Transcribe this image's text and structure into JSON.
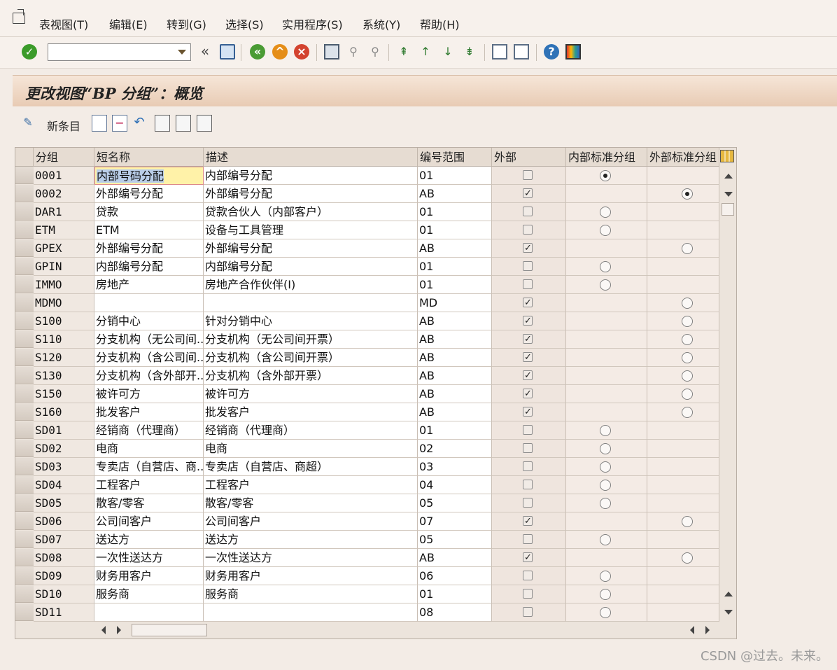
{
  "menu": [
    "表视图(T)",
    "编辑(E)",
    "转到(G)",
    "选择(S)",
    "实用程序(S)",
    "系统(Y)",
    "帮助(H)"
  ],
  "toolbar": {
    "command_value": ""
  },
  "title": "更改视图“BP 分组”：概览",
  "appbar": {
    "new_entry": "新条目"
  },
  "columns": [
    "分组",
    "短名称",
    "描述",
    "编号范围",
    "外部",
    "内部标准分组",
    "外部标准分组"
  ],
  "rows": [
    {
      "group": "0001",
      "short": "内部号码分配",
      "desc": "内部编号分配",
      "range": "01",
      "external": false,
      "internal_std": true,
      "internal_std_checked": true,
      "external_std": false,
      "external_std_checked": false
    },
    {
      "group": "0002",
      "short": "外部编号分配",
      "desc": "外部编号分配",
      "range": "AB",
      "external": true,
      "internal_std": false,
      "internal_std_checked": false,
      "external_std": true,
      "external_std_checked": true
    },
    {
      "group": "DAR1",
      "short": "贷款",
      "desc": "贷款合伙人（内部客户）",
      "range": "01",
      "external": false,
      "internal_std": true,
      "internal_std_checked": false,
      "external_std": false,
      "external_std_checked": false
    },
    {
      "group": "ETM",
      "short": "ETM",
      "desc": "设备与工具管理",
      "range": "01",
      "external": false,
      "internal_std": true,
      "internal_std_checked": false,
      "external_std": false,
      "external_std_checked": false
    },
    {
      "group": "GPEX",
      "short": "外部编号分配",
      "desc": "外部编号分配",
      "range": "AB",
      "external": true,
      "internal_std": false,
      "internal_std_checked": false,
      "external_std": true,
      "external_std_checked": false
    },
    {
      "group": "GPIN",
      "short": "内部编号分配",
      "desc": "内部编号分配",
      "range": "01",
      "external": false,
      "internal_std": true,
      "internal_std_checked": false,
      "external_std": false,
      "external_std_checked": false
    },
    {
      "group": "IMMO",
      "short": "房地产",
      "desc": "房地产合作伙伴(I)",
      "range": "01",
      "external": false,
      "internal_std": true,
      "internal_std_checked": false,
      "external_std": false,
      "external_std_checked": false
    },
    {
      "group": "MDMO",
      "short": "",
      "desc": "",
      "range": "MD",
      "external": true,
      "internal_std": false,
      "internal_std_checked": false,
      "external_std": true,
      "external_std_checked": false
    },
    {
      "group": "S100",
      "short": "分销中心",
      "desc": "针对分销中心",
      "range": "AB",
      "external": true,
      "internal_std": false,
      "internal_std_checked": false,
      "external_std": true,
      "external_std_checked": false
    },
    {
      "group": "S110",
      "short": "分支机构（无公司间...",
      "desc": "分支机构（无公司间开票）",
      "range": "AB",
      "external": true,
      "internal_std": false,
      "internal_std_checked": false,
      "external_std": true,
      "external_std_checked": false
    },
    {
      "group": "S120",
      "short": "分支机构（含公司间...",
      "desc": "分支机构（含公司间开票）",
      "range": "AB",
      "external": true,
      "internal_std": false,
      "internal_std_checked": false,
      "external_std": true,
      "external_std_checked": false
    },
    {
      "group": "S130",
      "short": "分支机构（含外部开...",
      "desc": "分支机构（含外部开票）",
      "range": "AB",
      "external": true,
      "internal_std": false,
      "internal_std_checked": false,
      "external_std": true,
      "external_std_checked": false
    },
    {
      "group": "S150",
      "short": "被许可方",
      "desc": "被许可方",
      "range": "AB",
      "external": true,
      "internal_std": false,
      "internal_std_checked": false,
      "external_std": true,
      "external_std_checked": false
    },
    {
      "group": "S160",
      "short": "批发客户",
      "desc": "批发客户",
      "range": "AB",
      "external": true,
      "internal_std": false,
      "internal_std_checked": false,
      "external_std": true,
      "external_std_checked": false
    },
    {
      "group": "SD01",
      "short": "经销商（代理商）",
      "desc": "经销商（代理商）",
      "range": "01",
      "external": false,
      "internal_std": true,
      "internal_std_checked": false,
      "external_std": false,
      "external_std_checked": false
    },
    {
      "group": "SD02",
      "short": "电商",
      "desc": "电商",
      "range": "02",
      "external": false,
      "internal_std": true,
      "internal_std_checked": false,
      "external_std": false,
      "external_std_checked": false
    },
    {
      "group": "SD03",
      "short": "专卖店（自营店、商...",
      "desc": "专卖店（自营店、商超）",
      "range": "03",
      "external": false,
      "internal_std": true,
      "internal_std_checked": false,
      "external_std": false,
      "external_std_checked": false
    },
    {
      "group": "SD04",
      "short": "工程客户",
      "desc": "工程客户",
      "range": "04",
      "external": false,
      "internal_std": true,
      "internal_std_checked": false,
      "external_std": false,
      "external_std_checked": false
    },
    {
      "group": "SD05",
      "short": "散客/零客",
      "desc": "散客/零客",
      "range": "05",
      "external": false,
      "internal_std": true,
      "internal_std_checked": false,
      "external_std": false,
      "external_std_checked": false
    },
    {
      "group": "SD06",
      "short": "公司间客户",
      "desc": "公司间客户",
      "range": "07",
      "external": true,
      "internal_std": false,
      "internal_std_checked": false,
      "external_std": true,
      "external_std_checked": false
    },
    {
      "group": "SD07",
      "short": "送达方",
      "desc": "送达方",
      "range": "05",
      "external": false,
      "internal_std": true,
      "internal_std_checked": false,
      "external_std": false,
      "external_std_checked": false
    },
    {
      "group": "SD08",
      "short": "一次性送达方",
      "desc": "一次性送达方",
      "range": "AB",
      "external": true,
      "internal_std": false,
      "internal_std_checked": false,
      "external_std": true,
      "external_std_checked": false
    },
    {
      "group": "SD09",
      "short": "财务用客户",
      "desc": "财务用客户",
      "range": "06",
      "external": false,
      "internal_std": true,
      "internal_std_checked": false,
      "external_std": false,
      "external_std_checked": false
    },
    {
      "group": "SD10",
      "short": "服务商",
      "desc": "服务商",
      "range": "01",
      "external": false,
      "internal_std": true,
      "internal_std_checked": false,
      "external_std": false,
      "external_std_checked": false
    },
    {
      "group": "SD11",
      "short": "",
      "desc": "",
      "range": "08",
      "external": false,
      "internal_std": true,
      "internal_std_checked": false,
      "external_std": false,
      "external_std_checked": false
    }
  ],
  "footer": "CSDN @过去。未来。"
}
